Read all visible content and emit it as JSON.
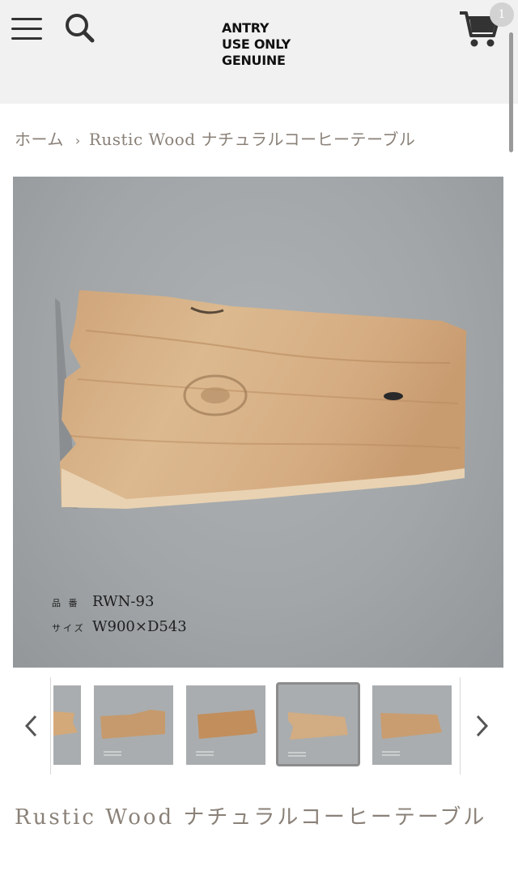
{
  "header": {
    "logo_lines": [
      "ANTRY",
      "USE ONLY",
      "GENUINE"
    ],
    "cart_count": "1",
    "icons": [
      "menu-icon",
      "search-icon",
      "cart-icon"
    ]
  },
  "breadcrumb": {
    "home": "ホーム",
    "separator": "›",
    "current": "Rustic Wood ナチュラルコーヒーテーブル"
  },
  "product": {
    "spec_code_label": "品 番",
    "spec_code_value": "RWN-93",
    "spec_size_label": "サイズ",
    "spec_size_value": "W900×D543",
    "title": "Rustic Wood ナチュラルコーヒーテーブル"
  },
  "gallery": {
    "prev_icon": "chevron-left-icon",
    "next_icon": "chevron-right-icon",
    "selected_index": 3
  },
  "colors": {
    "header_bg": "#f1f1f1",
    "text_muted": "#8a8178",
    "wood": "#d8b48a",
    "backdrop": "#a2a6a8"
  }
}
